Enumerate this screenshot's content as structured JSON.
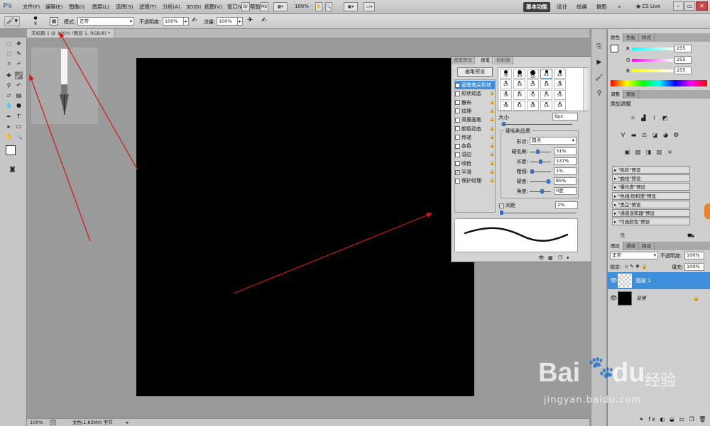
{
  "app": {
    "logo": "Ps",
    "menu": [
      "文件(F)",
      "编辑(E)",
      "图像(I)",
      "图层(L)",
      "选择(S)",
      "滤镜(T)",
      "分析(A)",
      "3D(D)",
      "视图(V)",
      "窗口(W)",
      "帮助(H)"
    ],
    "zoom": "100%",
    "workspaces": [
      "基本功能",
      "设计",
      "绘画",
      "摄影"
    ],
    "more": "»",
    "cslive": "CS Live"
  },
  "options": {
    "size": "8",
    "mode_label": "模式:",
    "mode": "正常",
    "opacity_label": "不透明度:",
    "opacity": "100%",
    "flow_label": "流量:",
    "flow": "100%"
  },
  "doc": {
    "tab": "未标题-1 @ 100% (图层 1, RGB/8) *",
    "zoom": "100%",
    "status": "文档:1.83M/0 字节"
  },
  "brush": {
    "tabs": [
      "画笔预设",
      "画笔",
      "仿制源"
    ],
    "preset_btn": "画笔预设",
    "items": [
      {
        "label": "画笔笔尖形状",
        "checked": false,
        "lock": false,
        "selected": true
      },
      {
        "label": "形状动态",
        "checked": false,
        "lock": true
      },
      {
        "label": "散布",
        "checked": false,
        "lock": true
      },
      {
        "label": "纹理",
        "checked": false,
        "lock": true
      },
      {
        "label": "双重画笔",
        "checked": false,
        "lock": true
      },
      {
        "label": "颜色动态",
        "checked": false,
        "lock": true
      },
      {
        "label": "传递",
        "checked": false,
        "lock": true
      },
      {
        "label": "杂色",
        "checked": false,
        "lock": true
      },
      {
        "label": "湿边",
        "checked": false,
        "lock": true
      },
      {
        "label": "喷枪",
        "checked": false,
        "lock": true
      },
      {
        "label": "平滑",
        "checked": true,
        "lock": true
      },
      {
        "label": "保护纹理",
        "checked": false,
        "lock": true
      }
    ],
    "tips": [
      "30",
      "30",
      "30",
      "25",
      "25",
      "25",
      "36",
      "25",
      "36",
      "36",
      "36",
      "36",
      "32",
      "25",
      "50",
      "36",
      "32",
      "25",
      "14",
      "24"
    ],
    "size_label": "大小",
    "size": "8px",
    "bristle_title": "硬毛刷品质",
    "shape_label": "形状:",
    "shape": "圆点",
    "params": [
      {
        "label": "硬毛刷:",
        "value": "31%",
        "pos": 0.31
      },
      {
        "label": "长度:",
        "value": "137%",
        "pos": 0.45
      },
      {
        "label": "粗细:",
        "value": "1%",
        "pos": 0.02
      },
      {
        "label": "硬度:",
        "value": "85%",
        "pos": 0.85
      },
      {
        "label": "角度:",
        "value": "0度",
        "pos": 0.55
      }
    ],
    "spacing_label": "间距",
    "spacing": "2%"
  },
  "color": {
    "tabs": [
      "颜色",
      "色板",
      "样式"
    ],
    "r_label": "R",
    "g_label": "G",
    "b_label": "B",
    "r": "255",
    "g": "255",
    "b": "255"
  },
  "adjust": {
    "tabs": [
      "调整",
      "蒙版"
    ],
    "title": "添加调整",
    "presets": [
      "\"色阶\"预设",
      "\"曲线\"预设",
      "\"曝光度\"预设",
      "\"色相/饱和度\"预设",
      "\"黑白\"预设",
      "\"通道混和器\"预设",
      "\"可选颜色\"预设"
    ]
  },
  "layers": {
    "tabs": [
      "图层",
      "通道",
      "路径"
    ],
    "blend": "正常",
    "opacity_label": "不透明度:",
    "opacity": "100%",
    "lock_label": "锁定:",
    "fill_label": "填充:",
    "fill": "100%",
    "items": [
      {
        "name": "图层 1",
        "selected": true
      },
      {
        "name": "背景",
        "selected": false
      }
    ]
  },
  "watermark": {
    "brand": "Bai",
    "brand2": "du",
    "cn": "经验",
    "url": "jingyan.baidu.com"
  }
}
